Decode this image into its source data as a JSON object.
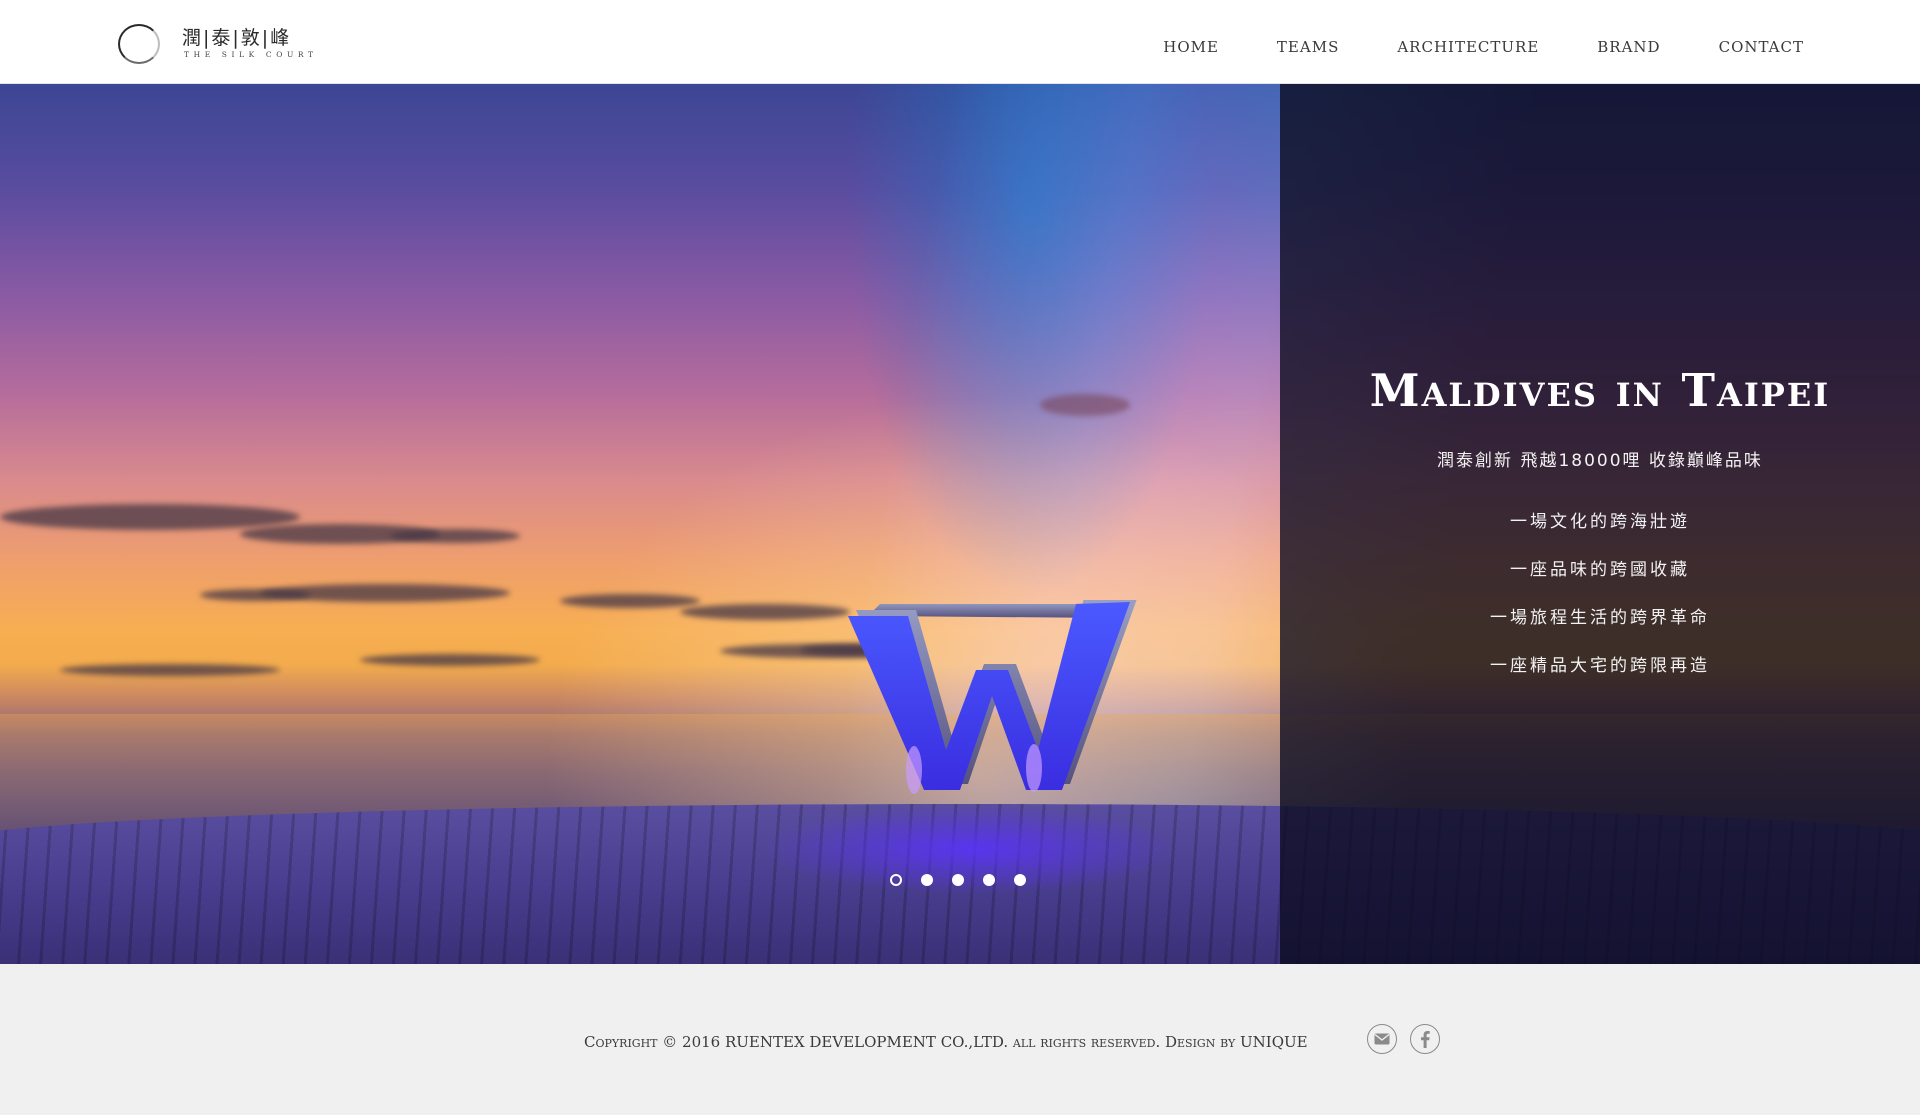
{
  "header": {
    "logo_cn": "潤|泰|敦|峰",
    "logo_en": "THE SILK COURT",
    "nav": [
      "HOME",
      "TEAMS",
      "ARCHITECTURE",
      "BRAND",
      "CONTACT"
    ]
  },
  "hero": {
    "title": "Maldives in Taipei",
    "subtitle": "潤泰創新 飛越18000哩 收錄巔峰品味",
    "lines": [
      "一場文化的跨海壯遊",
      "一座品味的跨國收藏",
      "一場旅程生活的跨界革命",
      "一座精品大宅的跨限再造"
    ],
    "slide_count": 5,
    "active_slide": 1
  },
  "footer": {
    "copyright": "Copyright © 2016 RUENTEX DEVELOPMENT CO.,LTD. all rights reserved. Design by UNIQUE",
    "icons": [
      "mail-icon",
      "facebook-icon"
    ]
  },
  "colors": {
    "panel": "#0a0a1e",
    "footer_bg": "#f0f0f0",
    "text_dark": "#3a3a3a"
  }
}
